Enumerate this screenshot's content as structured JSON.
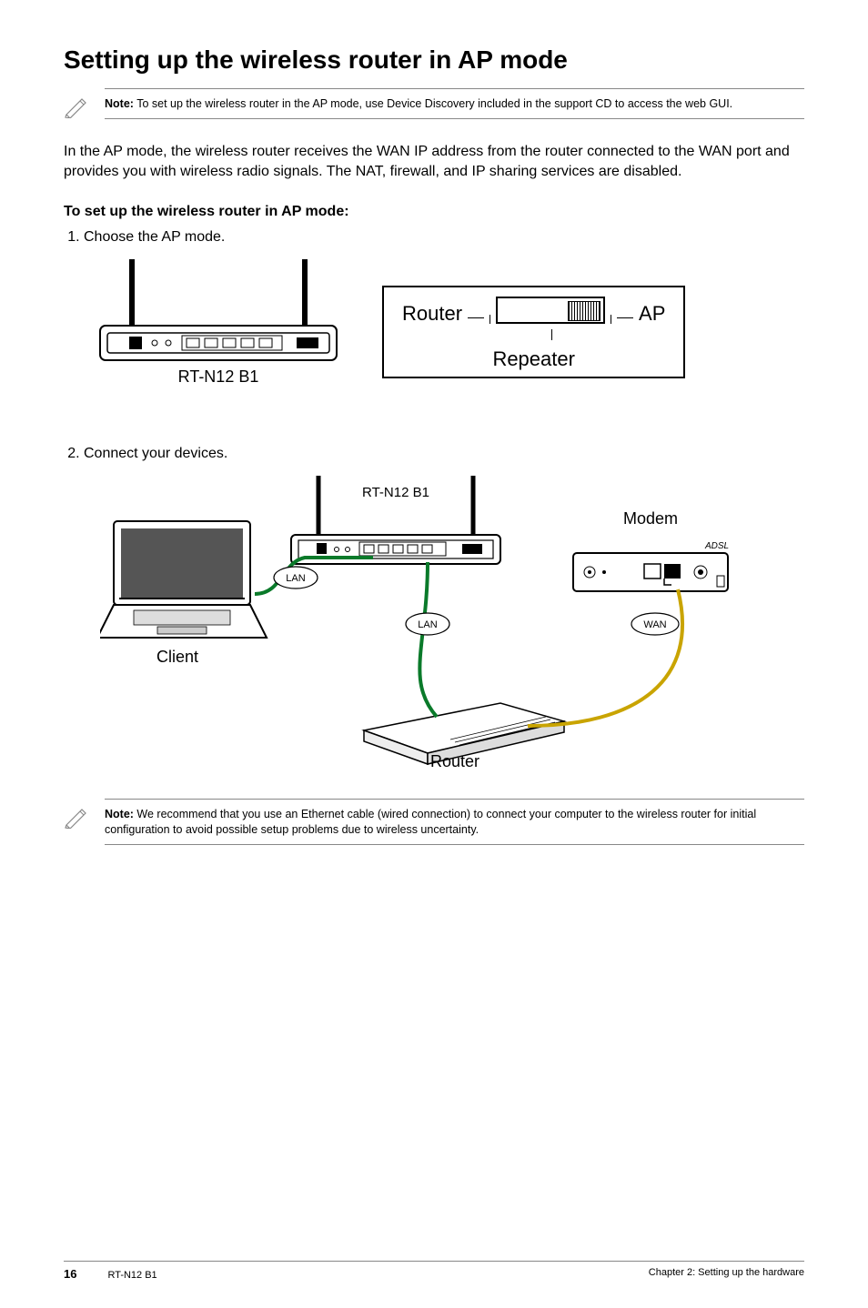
{
  "title": "Setting up the wireless router in AP mode",
  "note1": {
    "bold": "Note:",
    "text": " To set up the wireless router in the AP mode, use Device Discovery included in the support CD to access the web GUI."
  },
  "intro": "In the AP mode, the wireless router receives the WAN IP address from the router connected to the WAN port and provides you with wireless radio signals. The NAT, firewall, and IP sharing services are disabled.",
  "subhead": "To set up the wireless router in AP mode:",
  "steps": {
    "s1": "Choose the AP mode.",
    "s2": "Connect your devices."
  },
  "labels": {
    "device_model": "RT-N12 B1",
    "router": "Router",
    "ap": "AP",
    "repeater": "Repeater",
    "modem": "Modem",
    "client": "Client",
    "lan": "LAN",
    "wan": "WAN"
  },
  "note2": {
    "bold": "Note:",
    "text": " We recommend that you use an Ethernet cable (wired connection) to connect your computer to the wireless router for initial configuration to avoid possible setup problems due to wireless uncertainty."
  },
  "footer": {
    "page": "16",
    "model": "RT-N12 B1",
    "chapter": "Chapter 2: Setting up the hardware"
  }
}
